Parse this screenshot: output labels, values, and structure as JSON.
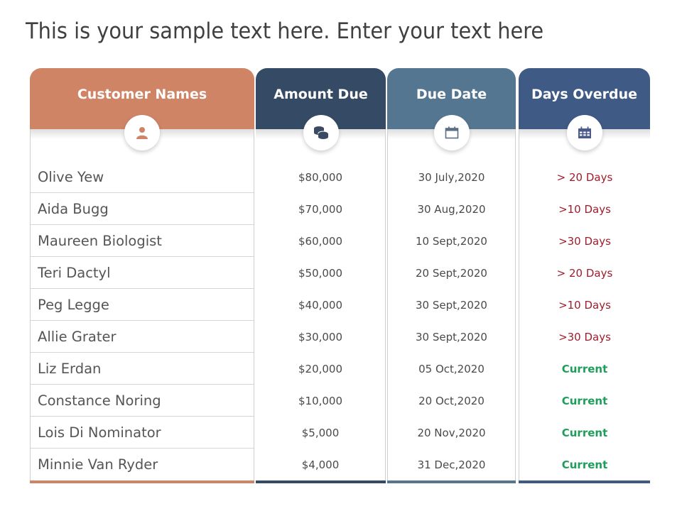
{
  "title": "This is your sample text here. Enter your text here",
  "colors": {
    "customer_header": "#cf8465",
    "amount_header": "#354b65",
    "due_date_header": "#557691",
    "overdue_header": "#3f5a85",
    "overdue_text": "#a01c2c",
    "current_text": "#1e9e5a"
  },
  "columns": [
    {
      "label": "Customer Names",
      "icon": "user-icon"
    },
    {
      "label": "Amount Due",
      "icon": "coins-icon"
    },
    {
      "label": "Due Date",
      "icon": "calendar-icon"
    },
    {
      "label": "Days Overdue",
      "icon": "calendar-grid-icon"
    }
  ],
  "rows": [
    {
      "name": "Olive Yew",
      "amount": "$80,000",
      "due_date": "30 July,2020",
      "overdue": "> 20 Days",
      "status": "overdue"
    },
    {
      "name": "Aida Bugg",
      "amount": "$70,000",
      "due_date": "30 Aug,2020",
      "overdue": ">10 Days",
      "status": "overdue"
    },
    {
      "name": "Maureen Biologist",
      "amount": "$60,000",
      "due_date": "10 Sept,2020",
      "overdue": ">30 Days",
      "status": "overdue"
    },
    {
      "name": "Teri Dactyl",
      "amount": "$50,000",
      "due_date": "20 Sept,2020",
      "overdue": "> 20 Days",
      "status": "overdue"
    },
    {
      "name": "Peg Legge",
      "amount": "$40,000",
      "due_date": "30 Sept,2020",
      "overdue": ">10 Days",
      "status": "overdue"
    },
    {
      "name": "Allie Grater",
      "amount": "$30,000",
      "due_date": "30 Sept,2020",
      "overdue": ">30 Days",
      "status": "overdue"
    },
    {
      "name": "Liz Erdan",
      "amount": "$20,000",
      "due_date": "05 Oct,2020",
      "overdue": "Current",
      "status": "current"
    },
    {
      "name": "Constance Noring",
      "amount": "$10,000",
      "due_date": "20 Oct,2020",
      "overdue": "Current",
      "status": "current"
    },
    {
      "name": "Lois Di Nominator",
      "amount": "$5,000",
      "due_date": "20 Nov,2020",
      "overdue": "Current",
      "status": "current"
    },
    {
      "name": "Minnie Van Ryder",
      "amount": "$4,000",
      "due_date": "31 Dec,2020",
      "overdue": "Current",
      "status": "current"
    }
  ]
}
